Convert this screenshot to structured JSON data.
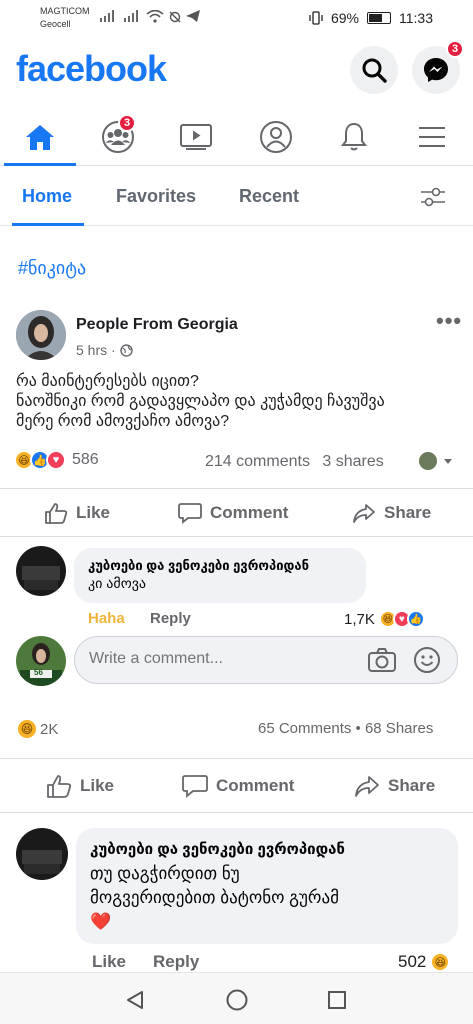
{
  "status_bar": {
    "carrier1": "MAGTICOM",
    "carrier2": "Geocell",
    "battery_percent": "69%",
    "battery_level": 0.69,
    "time": "11:33"
  },
  "header": {
    "logo": "facebook",
    "messenger_badge": "3",
    "icons": [
      "search-icon",
      "messenger-icon"
    ]
  },
  "nav": {
    "items": [
      "home-icon",
      "friends-icon",
      "watch-icon",
      "profile-icon",
      "notifications-icon",
      "menu-icon"
    ],
    "friends_badge": "3",
    "accent_color": "#1877f2"
  },
  "tabs": [
    "Home",
    "Favorites",
    "Recent"
  ],
  "hashtag": "#ნიკიტა",
  "post": {
    "author": "People From Georgia",
    "time": "5 hrs · ",
    "text_lines": [
      "რა მაინტერესებს იცით?",
      "ნაოშნიკი რომ გადავყლაპო და კუჭამდე ჩავუშვა",
      "მერე რომ ამოვქაჩო ამოვა?"
    ],
    "reactions_count": "586",
    "comments": "214 comments",
    "shares": "3 shares",
    "actions": {
      "like": "Like",
      "comment": "Comment",
      "share": "Share"
    }
  },
  "comment1": {
    "author": "კუბოები და ვენოკები ევროპიდან",
    "text": "კი ამოვა",
    "haha": "Haha",
    "reply": "Reply",
    "count": "1,7K"
  },
  "write_comment": {
    "placeholder": "Write a comment..."
  },
  "commenter_avatar_label": "56",
  "stats2": {
    "reactions": "2K",
    "comments_shares": "65 Comments • 68 Shares"
  },
  "actions2": {
    "like": "Like",
    "comment": "Comment",
    "share": "Share"
  },
  "comment2": {
    "author": "კუბოები და ვენოკები ევროპიდან",
    "text_lines": [
      "თუ დაგჭირდით ნუ",
      "მოგვერიდებით  ბატონო გურამ"
    ],
    "emoji": "❤️",
    "like": "Like",
    "reply": "Reply",
    "count": "502"
  }
}
